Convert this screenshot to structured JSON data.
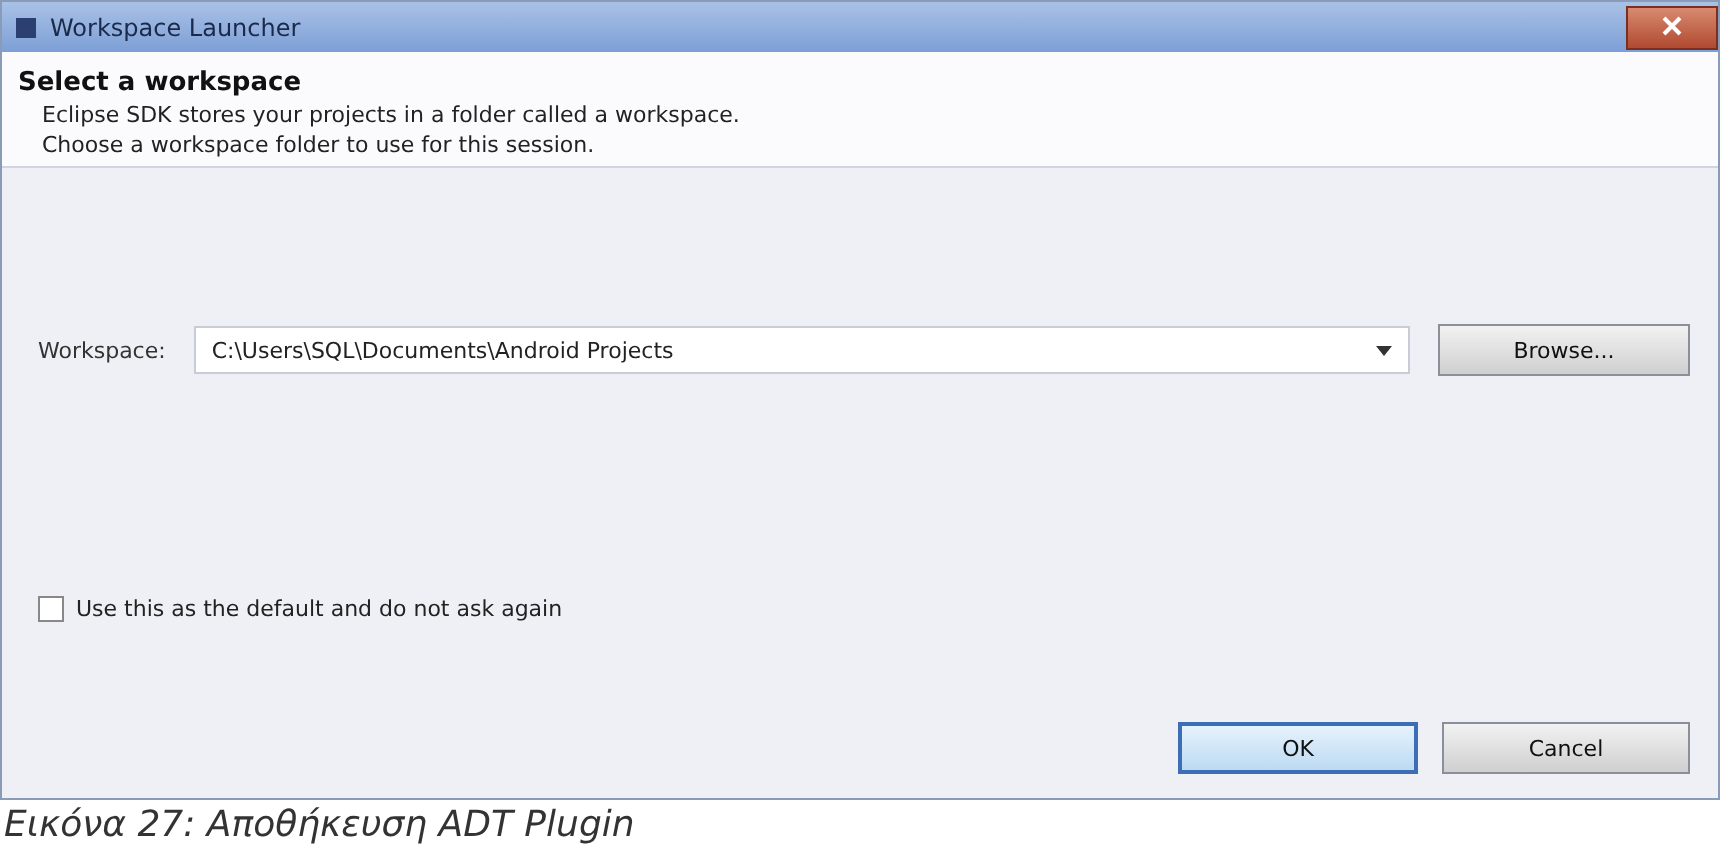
{
  "window": {
    "title": "Workspace Launcher"
  },
  "header": {
    "title": "Select a workspace",
    "lines": [
      "Eclipse SDK stores your projects in a folder called a workspace.",
      "Choose a workspace folder to use for this session."
    ]
  },
  "workspace": {
    "label": "Workspace:",
    "value": "C:\\Users\\SQL\\Documents\\Android Projects",
    "browse": "Browse..."
  },
  "default_checkbox": {
    "label": "Use this as the default and do not ask again",
    "checked": false
  },
  "buttons": [
    {
      "label": "OK",
      "selected": true
    },
    {
      "label": "Cancel",
      "selected": false
    }
  ],
  "caption": "Εικόνα 27: Αποθήκευση ADT Plugin"
}
